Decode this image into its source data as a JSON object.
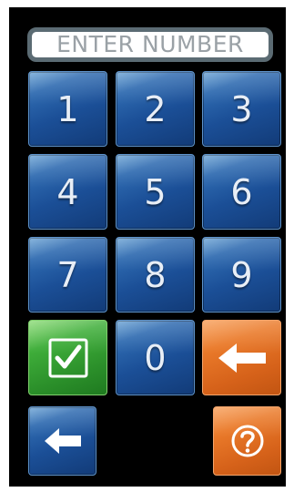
{
  "display": {
    "placeholder": "ENTER NUMBER"
  },
  "keypad": {
    "digits": [
      "1",
      "2",
      "3",
      "4",
      "5",
      "6",
      "7",
      "8",
      "9",
      "0"
    ]
  },
  "icons": {
    "confirm": "check-icon",
    "backspace": "arrow-left-icon",
    "back": "arrow-left-icon",
    "help": "question-icon"
  },
  "colors": {
    "panel": "#000000",
    "key_blue": "#1b4f97",
    "key_green": "#2b8f2a",
    "key_orange": "#d6621a",
    "display_border": "#5b6b73",
    "display_text": "#9aa1a6"
  }
}
